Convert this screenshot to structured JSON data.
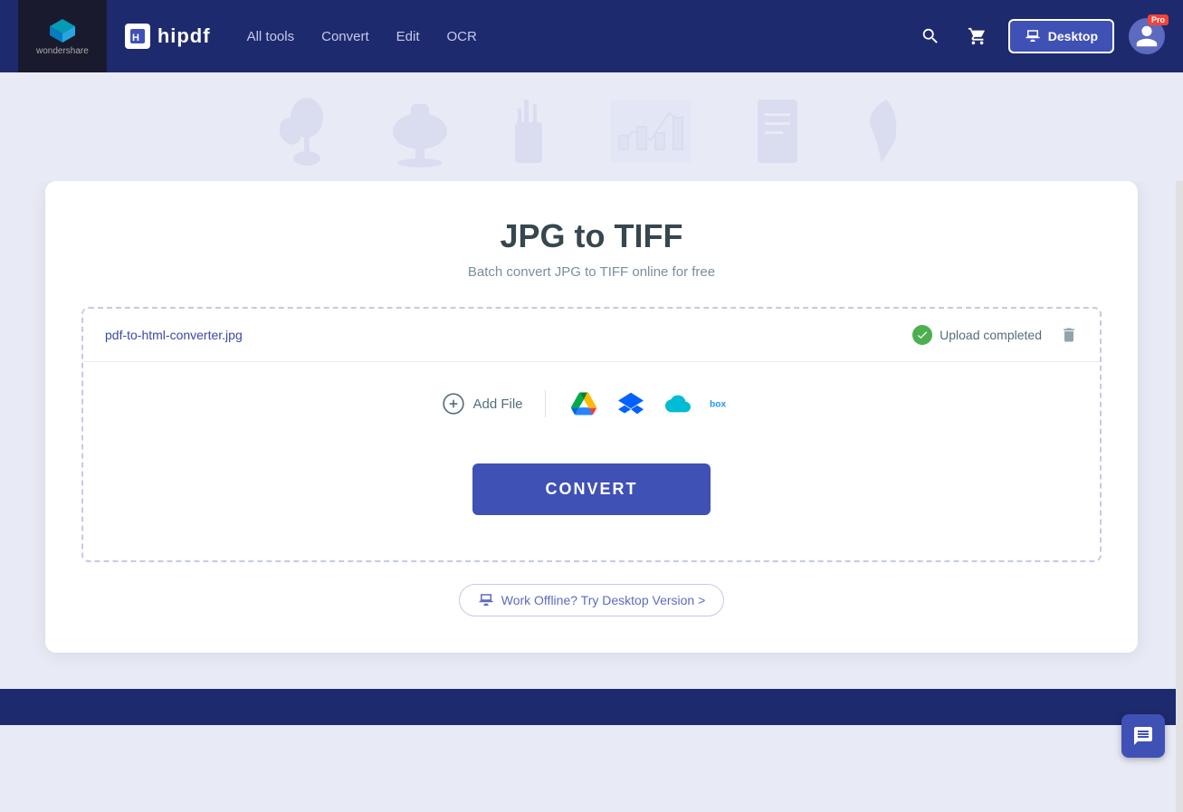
{
  "brand": {
    "wondershare_label": "wondershare",
    "hipdf_label": "hipdf"
  },
  "navbar": {
    "all_tools": "All tools",
    "convert": "Convert",
    "edit": "Edit",
    "ocr": "OCR",
    "desktop_btn": "Desktop",
    "pro_label": "Pro"
  },
  "hero": {
    "title": "JPG to TIFF",
    "subtitle": "Batch convert JPG to TIFF online for free"
  },
  "file": {
    "name": "pdf-to-html-converter.jpg",
    "status": "Upload completed",
    "add_file_label": "Add File"
  },
  "convert_btn": "CONVERT",
  "offline": {
    "label": "Work Offline? Try Desktop Version >"
  }
}
